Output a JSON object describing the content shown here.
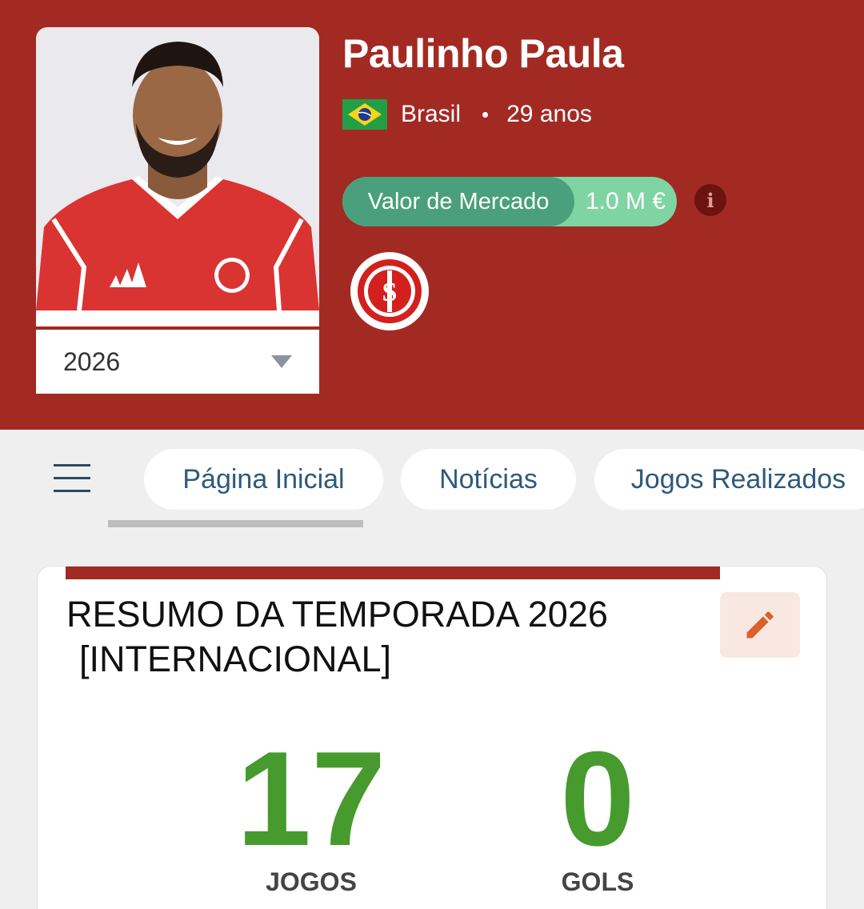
{
  "player": {
    "name": "Paulinho Paula",
    "country": "Brasil",
    "age": "29 anos",
    "separator": "•"
  },
  "market": {
    "label": "Valor de Mercado",
    "value": "1.0 M €",
    "info_icon": "i"
  },
  "season_select": {
    "value": "2026"
  },
  "nav": {
    "menu_icon": "hamburger-menu-icon",
    "tabs": [
      {
        "label": "Página Inicial",
        "active": true
      },
      {
        "label": "Notícias",
        "active": false
      },
      {
        "label": "Jogos Realizados",
        "active": false
      }
    ]
  },
  "summary": {
    "title": "RESUMO DA TEMPORADA 2026",
    "team": "[INTERNACIONAL]",
    "stats": [
      {
        "value": "17",
        "label": "JOGOS"
      },
      {
        "value": "0",
        "label": "GOLS"
      }
    ]
  },
  "colors": {
    "header": "#a22a22",
    "stat_green": "#479a2d",
    "tab_text": "#2d5a7b",
    "pill_dark": "#4aa07c",
    "pill_light": "#7fd4a3"
  }
}
